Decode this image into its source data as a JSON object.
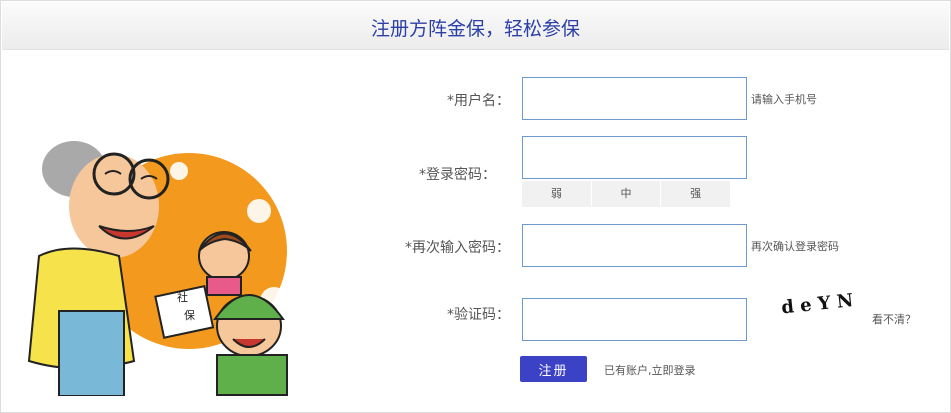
{
  "header": {
    "title": "注册方阵金保，轻松参保"
  },
  "illustration": {
    "sign_text_1": "社",
    "sign_text_2": "保"
  },
  "form": {
    "username": {
      "label": "*用户名：",
      "placeholder": "",
      "hint": "请输入手机号"
    },
    "password": {
      "label": "*登录密码：",
      "placeholder": "",
      "strength": [
        "弱",
        "中",
        "强"
      ]
    },
    "confirm_password": {
      "label": "*再次输入密码：",
      "placeholder": "",
      "hint": "再次确认登录密码"
    },
    "captcha": {
      "label": "*验证码：",
      "placeholder": "",
      "code_text": "d e Y N",
      "refresh_label": "看不清？"
    }
  },
  "actions": {
    "submit_label": "注册",
    "login_link": "已有账户,立即登录"
  },
  "colors": {
    "accent": "#3b42c6",
    "title": "#2c3fa6",
    "input_border": "#6e9ad0",
    "illustration_orange": "#f39a1e"
  }
}
